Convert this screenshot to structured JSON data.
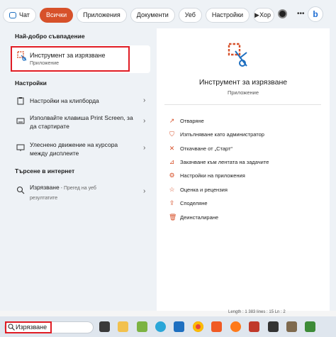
{
  "filters": {
    "items": [
      {
        "label": "Чат",
        "icon": "chat-bubble-icon"
      },
      {
        "label": "Всички",
        "active": true
      },
      {
        "label": "Приложения"
      },
      {
        "label": "Документи"
      },
      {
        "label": "Уеб"
      },
      {
        "label": "Настройки"
      },
      {
        "label": "Хор"
      }
    ],
    "play_icon": "▶",
    "more_icon": "•••",
    "bing_label": "b"
  },
  "best_match": {
    "section_title": "Най-добро съвпадение",
    "title": "Инструмент за изрязване",
    "subtitle": "Приложение",
    "icon": "snipping-tool-icon"
  },
  "settings": {
    "section_title": "Настройки",
    "items": [
      {
        "label": "Настройки на клипборда"
      },
      {
        "label": "Изполвайте клавиша Print Screen, за да стартирате"
      },
      {
        "label": "Улеснено движение на курсора между дисплеите"
      }
    ]
  },
  "web": {
    "section_title": "Търсене в интернет",
    "query": "Изрязване",
    "suffix": " - Прегед на уеб резултатите"
  },
  "detail": {
    "app_name": "Инструмент за изрязване",
    "app_type": "Приложение",
    "actions": [
      {
        "label": "Отваряне",
        "icon": "open-icon",
        "glyph": "↗"
      },
      {
        "label": "Изпълняване като администратор",
        "icon": "admin-shield-icon",
        "glyph": "⛉"
      },
      {
        "label": "Откачване от „Старт“",
        "icon": "unpin-icon",
        "glyph": "✕"
      },
      {
        "label": "Закачване към лентата на задачите",
        "icon": "pin-icon",
        "glyph": "⊿"
      },
      {
        "label": "Настройки на приложения",
        "icon": "gear-icon",
        "glyph": "⚙"
      },
      {
        "label": "Оценка и рецензия",
        "icon": "star-icon",
        "glyph": "☆"
      },
      {
        "label": "Споделяне",
        "icon": "share-icon",
        "glyph": "⇪"
      },
      {
        "label": "Деинсталиране",
        "icon": "trash-icon",
        "glyph": "🗑"
      }
    ]
  },
  "status_bar": {
    "text": "Length : 1 383    lines : 15    Ln : 2"
  },
  "taskbar": {
    "search_value": "Изрязване",
    "apps": [
      "task-view-icon",
      "explorer-icon",
      "notepadpp-icon",
      "edge-icon",
      "store-icon",
      "chrome-icon",
      "brave-icon",
      "firefox-icon",
      "app-icon",
      "app-icon-2",
      "gimp-icon",
      "vim-icon"
    ]
  }
}
